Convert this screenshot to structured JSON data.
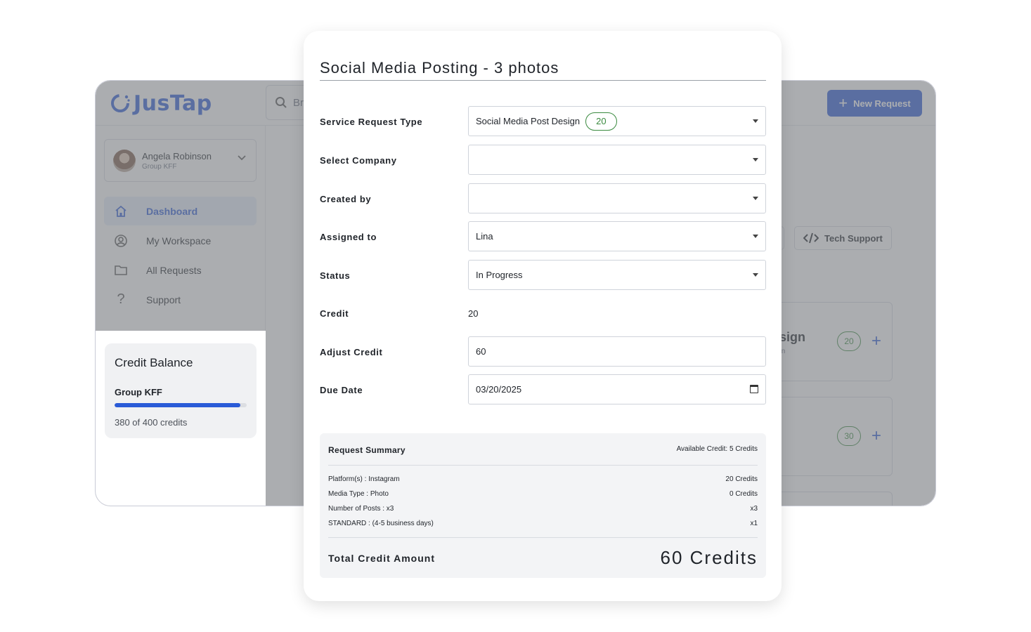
{
  "app": {
    "logo_text": "JusTap",
    "search_placeholder": "Br",
    "new_request_label": "New Request",
    "user": {
      "name": "Angela Robinson",
      "group": "Group KFF"
    },
    "nav": [
      {
        "label": "Dashboard",
        "icon": "home-icon",
        "active": true
      },
      {
        "label": "My Workspace",
        "icon": "user-circle-icon",
        "active": false
      },
      {
        "label": "All Requests",
        "icon": "folder-icon",
        "active": false
      },
      {
        "label": "Support",
        "icon": "question-icon",
        "active": false
      }
    ],
    "category": {
      "tech_support_label": "Tech Support"
    },
    "service_cards": [
      {
        "title": "esign",
        "subtitle": "sign",
        "credits": "20"
      },
      {
        "title": "",
        "subtitle": "",
        "credits": "30"
      }
    ],
    "credit_balance": {
      "title": "Credit Balance",
      "group": "Group KFF",
      "used": 380,
      "total": 400,
      "text": "380 of 400 credits"
    }
  },
  "modal": {
    "title": "Social Media Posting - 3 photos",
    "fields": {
      "service_type": {
        "label": "Service Request Type",
        "value": "Social Media Post Design",
        "badge": "20"
      },
      "company": {
        "label": "Select Company",
        "value": ""
      },
      "created_by": {
        "label": "Created by",
        "value": ""
      },
      "assigned_to": {
        "label": "Assigned to",
        "value": "Lina"
      },
      "status": {
        "label": "Status",
        "value": "In Progress"
      },
      "credit": {
        "label": "Credit",
        "value": "20"
      },
      "adjust_credit": {
        "label": "Adjust Credit",
        "value": "60"
      },
      "due_date": {
        "label": "Due Date",
        "value": "03/20/2025"
      }
    },
    "summary": {
      "heading": "Request Summary",
      "available": "Available Credit: 5 Credits",
      "lines": [
        {
          "label": "Platform(s) : Instagram",
          "value": "20 Credits"
        },
        {
          "label": "Media Type : Photo",
          "value": "0 Credits"
        },
        {
          "label": "Number of Posts : x3",
          "value": "x3"
        },
        {
          "label": "STANDARD : (4-5 business days)",
          "value": "x1"
        }
      ],
      "total_label": "Total Credit Amount",
      "total_value": "60 Credits"
    }
  },
  "colors": {
    "accent": "#2a5bd7",
    "badge_green": "#3a8a3f",
    "overlay": "#787b80"
  }
}
